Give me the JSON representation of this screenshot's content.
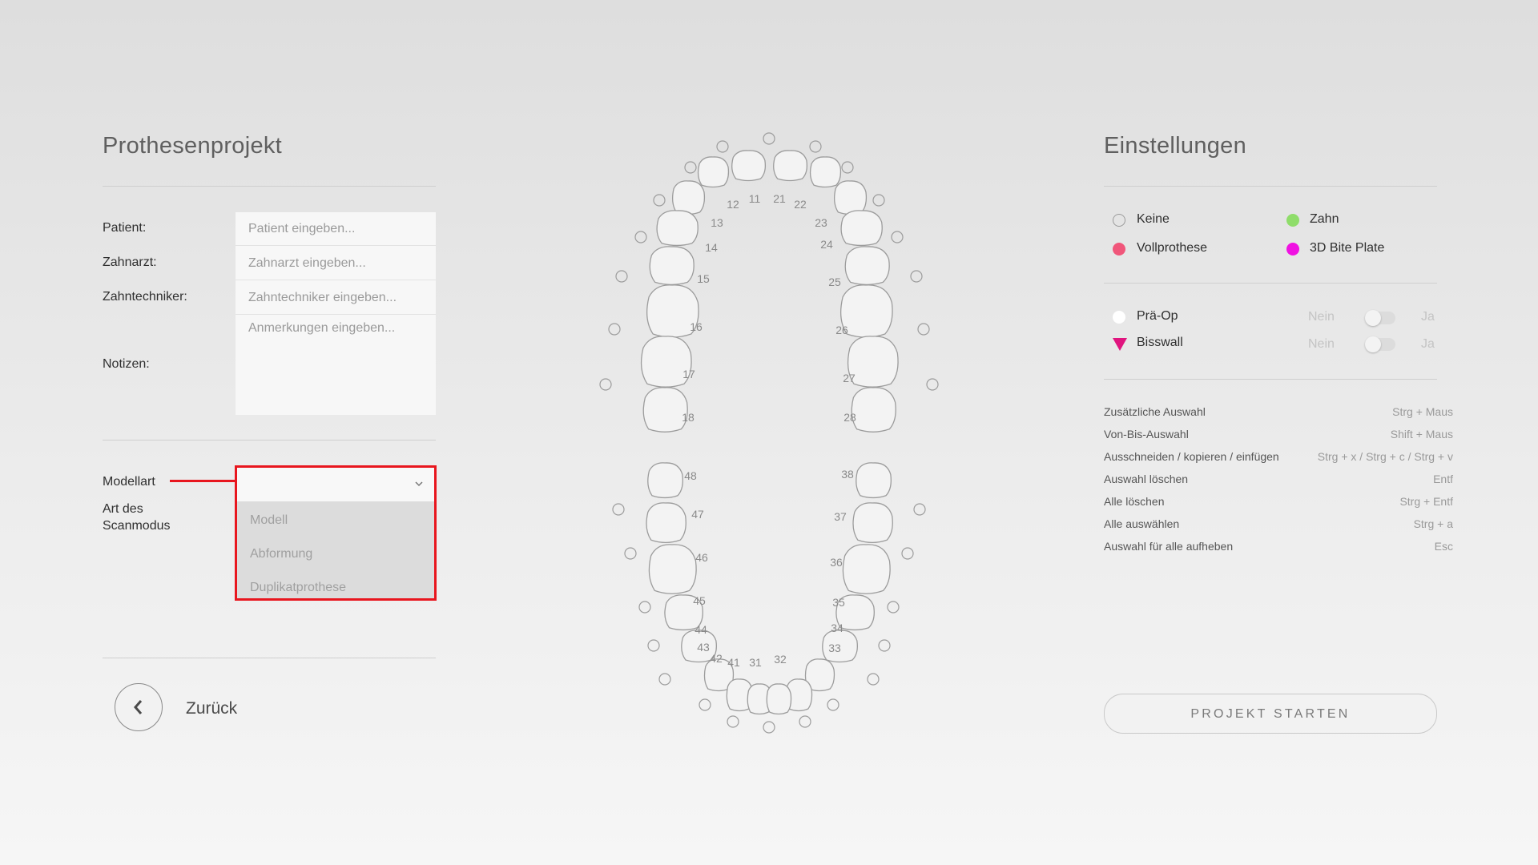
{
  "left": {
    "title": "Prothesenprojekt",
    "fields": {
      "patient_label": "Patient:",
      "patient_placeholder": "Patient eingeben...",
      "dentist_label": "Zahnarzt:",
      "dentist_placeholder": "Zahnarzt eingeben...",
      "technician_label": "Zahntechniker:",
      "technician_placeholder": "Zahntechniker eingeben...",
      "notes_label": "Notizen:",
      "notes_placeholder": "Anmerkungen eingeben..."
    },
    "model_label": "Modellart",
    "scan_label": "Art des Scanmodus",
    "model_dropdown": {
      "selected": "",
      "options": [
        "Modell",
        "Abformung",
        "Duplikatprothese"
      ]
    },
    "back_label": "Zurück"
  },
  "teeth": {
    "upper_numbers": [
      "12",
      "11",
      "21",
      "22",
      "13",
      "23",
      "14",
      "24",
      "15",
      "25",
      "16",
      "26",
      "17",
      "27",
      "18",
      "28"
    ],
    "lower_numbers": [
      "48",
      "38",
      "47",
      "37",
      "46",
      "36",
      "45",
      "35",
      "44",
      "34",
      "43",
      "33",
      "42",
      "41",
      "31",
      "32"
    ]
  },
  "right": {
    "title": "Einstellungen",
    "legend": [
      {
        "label": "Keine",
        "color": "#ffffff"
      },
      {
        "label": "Zahn",
        "color": "#8fdd6a"
      },
      {
        "label": "Vollprothese",
        "color": "#f0567a"
      },
      {
        "label": "3D Bite Plate",
        "color": "#f012e2"
      }
    ],
    "toggles": [
      {
        "label": "Prä-Op",
        "off": "Nein",
        "on": "Ja",
        "value": false
      },
      {
        "label": "Bisswall",
        "off": "Nein",
        "on": "Ja",
        "value": false
      }
    ],
    "shortcuts": [
      {
        "action": "Zusätzliche Auswahl",
        "keys": "Strg + Maus"
      },
      {
        "action": "Von-Bis-Auswahl",
        "keys": "Shift + Maus"
      },
      {
        "action": "Ausschneiden / kopieren / einfügen",
        "keys": "Strg + x / Strg + c / Strg + v"
      },
      {
        "action": "Auswahl löschen",
        "keys": "Entf"
      },
      {
        "action": "Alle löschen",
        "keys": "Strg + Entf"
      },
      {
        "action": "Alle auswählen",
        "keys": "Strg + a"
      },
      {
        "action": "Auswahl für alle aufheben",
        "keys": "Esc"
      }
    ],
    "start_button": "PROJEKT STARTEN"
  },
  "colors": {
    "accent_red": "#e8161e",
    "vollprothese": "#f0567a",
    "bite_plate": "#f012e2",
    "zahn": "#8fdd6a",
    "bisswall_triangle": "#e0157f"
  }
}
